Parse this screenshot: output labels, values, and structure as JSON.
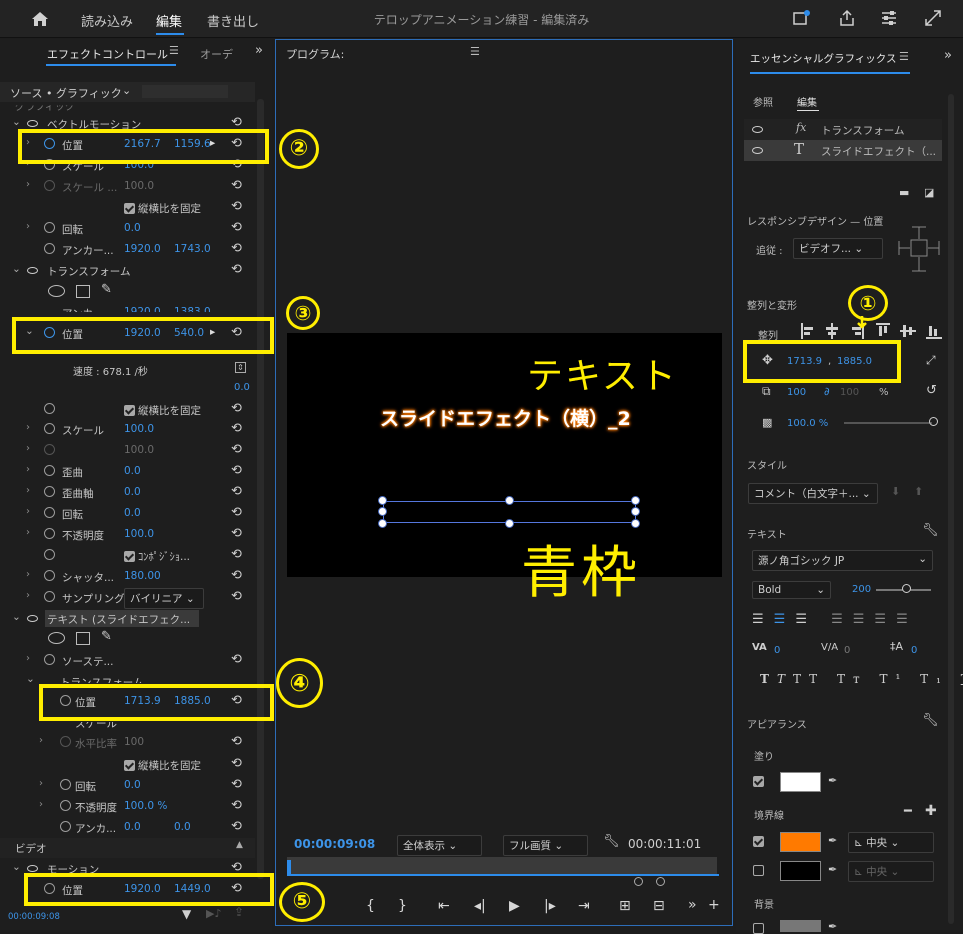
{
  "topbar": {
    "home_label": "",
    "tab_import": "読み込み",
    "tab_edit": "編集",
    "tab_export": "書き出し",
    "project_title": "テロップアニメーション練習 - 編集済み"
  },
  "left": {
    "tab_effect": "エフェクトコントロール",
    "tab_audio": "オーデ",
    "source_label": "ソース • グラフィック",
    "graphic_label": "グラフィック",
    "vector_motion": "ベクトルモーション",
    "position": "位置",
    "vm_pos_x": "2167.7",
    "vm_pos_y": "1159.6",
    "scale": "スケール",
    "vm_scale_val": "100.0",
    "scale_width": "スケール ...",
    "vm_scale_w": "100.0",
    "uniform": "縦横比を固定",
    "rotation": "回転",
    "vm_rot": "0.0",
    "anchor": "アンカー...",
    "vm_anchor_x": "1920.0",
    "vm_anchor_y": "1743.0",
    "transform": "トランスフォーム",
    "tf_anchor": "アンカー",
    "tf_anchor_x": "1920.0",
    "tf_anchor_y": "1383.0",
    "tf_pos_x": "1920.0",
    "tf_pos_y": "540.0",
    "speed": "速度 : 678.1 /秒",
    "speed_val": "0.0",
    "tf_scale": "100.0",
    "tf_scale2": "100.0",
    "skew": "歪曲",
    "skew_val": "0.0",
    "skew_axis": "歪曲軸",
    "skew_axis_val": "0.0",
    "tf_rot": "0.0",
    "opacity": "不透明度",
    "tf_opacity": "100.0",
    "composite": "ｺﾝﾎﾟｼﾞｼｮ...",
    "shutter": "シャッタ...",
    "shutter_val": "180.00",
    "sampling": "サンプリング",
    "sampling_val": "バイリニア",
    "text_layer": "テキスト (スライドエフェク...",
    "source_text": "ソーステ...",
    "text_transform": "トランスフォーム",
    "txt_pos_x": "1713.9",
    "txt_pos_y": "1885.0",
    "txt_scale": "スケール",
    "h_ratio": "水平比率",
    "h_ratio_val": "100",
    "txt_rot": "0.0",
    "txt_opacity": "100.0 %",
    "txt_anchor": "アンカ...",
    "txt_anchor_x": "0.0",
    "txt_anchor_y": "0.0",
    "video": "ビデオ",
    "motion": "モーション",
    "mo_pos_x": "1920.0",
    "mo_pos_y": "1449.0",
    "timecode": "00:00:09:08"
  },
  "program": {
    "title": "プログラム:",
    "clip_text": "スライドエフェクト（横）_2",
    "tc_current": "00:00:09:08",
    "fit": "全体表示",
    "quality": "フル画質",
    "tc_duration": "00:00:11:01"
  },
  "right": {
    "title": "エッセンシャルグラフィックス",
    "tab_browse": "参照",
    "tab_edit": "編集",
    "layer1": "トランスフォーム",
    "layer2": "スライドエフェクト（...",
    "responsive": "レスポンシブデザイン — 位置",
    "follow": "追従 :",
    "follow_val": "ビデオフ...",
    "align_transform": "整列と変形",
    "align": "整列",
    "pos_x": "1713.9",
    "pos_y": "1885.0",
    "scale_val": "100",
    "scale2_val": "100",
    "scale_unit": "%",
    "opacity": "100.0 %",
    "style": "スタイル",
    "style_val": "コメント（白文字＋...",
    "text": "テキスト",
    "font": "源ノ角ゴシック JP",
    "weight": "Bold",
    "size": "200",
    "kern_val": "0",
    "track_val": "0",
    "lead_val": "0",
    "appearance": "アピアランス",
    "fill": "塗り",
    "stroke": "境界線",
    "stroke1": "中央",
    "stroke2": "中央",
    "background": "背景"
  },
  "annotations": {
    "text_note": "テキスト",
    "blue_note": "青枠",
    "n1": "①",
    "n2": "②",
    "n3": "③",
    "n4": "④",
    "n5": "⑤"
  },
  "colors": {
    "accent": "#2d8ceb",
    "value_blue": "#3d94e8",
    "highlight": "#ffee00",
    "stroke_color": "#ff7a00"
  }
}
